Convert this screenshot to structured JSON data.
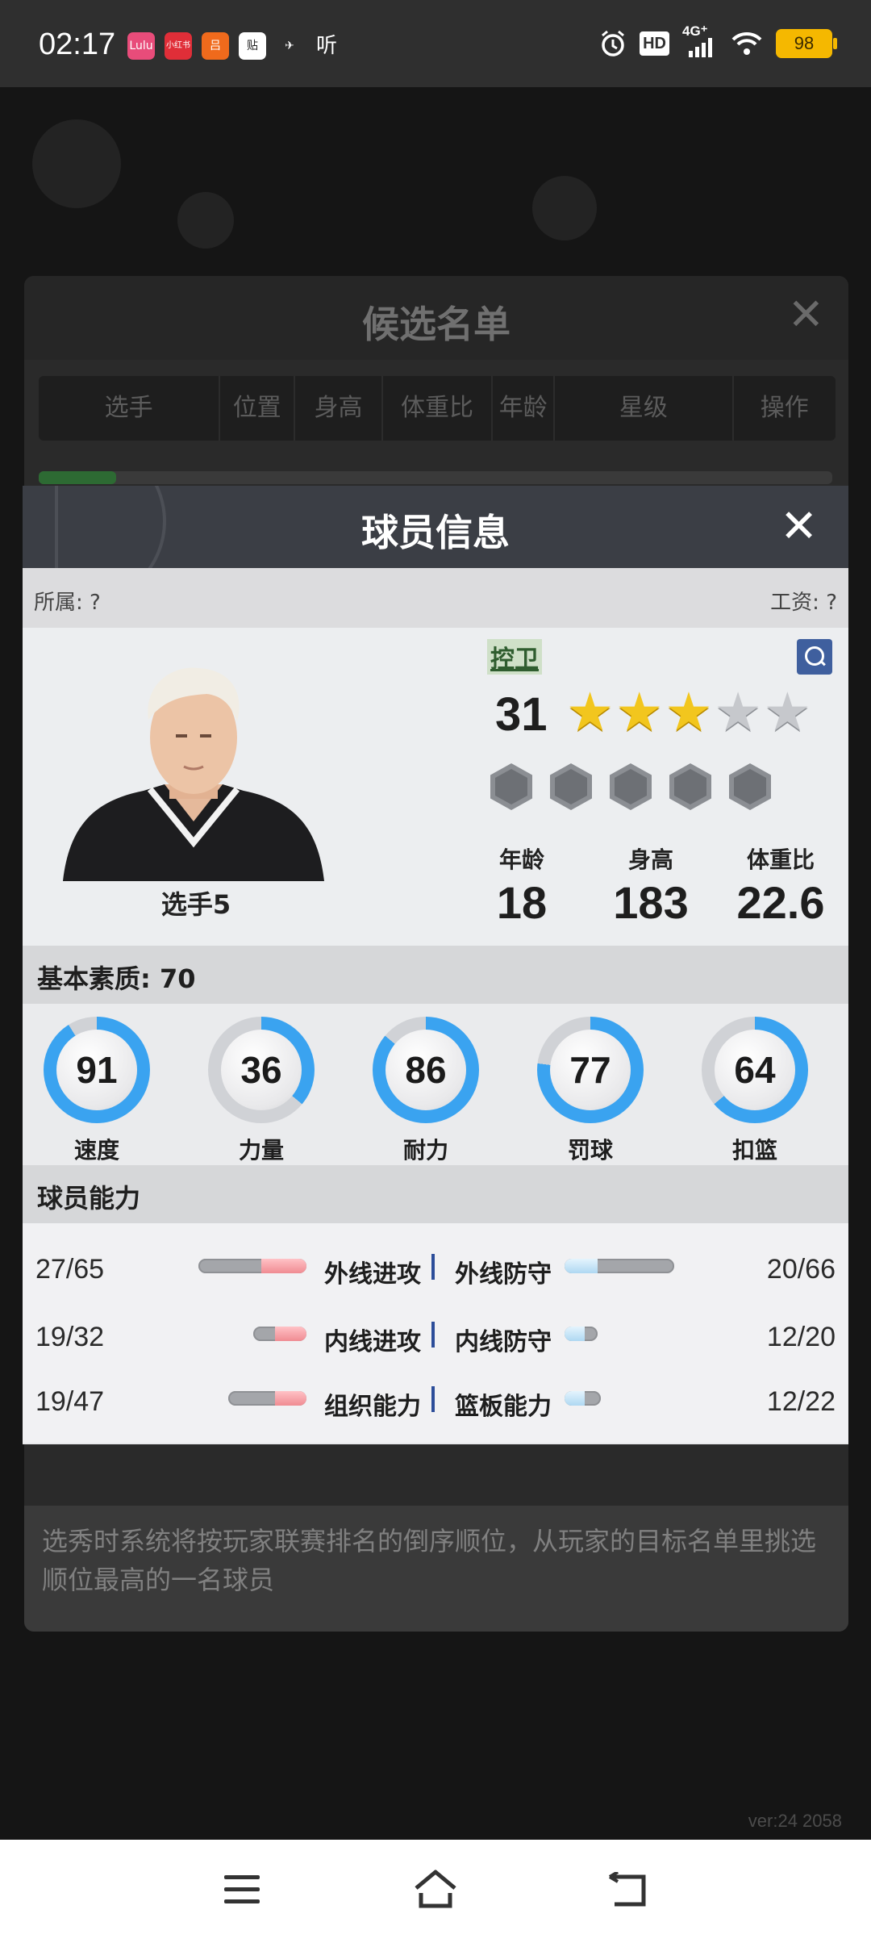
{
  "status_bar": {
    "time": "02:17",
    "apps": [
      "Lulu",
      "小红书",
      "吕",
      "贴",
      "✈",
      "听"
    ],
    "net_label": "4G⁺",
    "hd_label": "HD",
    "battery": "98"
  },
  "background": {
    "candidate_title": "候选名单",
    "columns": [
      "选手",
      "位置",
      "身高",
      "体重比",
      "年龄",
      "星级",
      "操作"
    ],
    "note": "选秀时系统将按玩家联赛排名的倒序顺位，从玩家的目标名单里挑选顺位最高的一名球员",
    "version": "ver:24  2058"
  },
  "modal": {
    "title": "球员信息",
    "affiliation": "所属: ?",
    "salary": "工资: ?",
    "player": {
      "name": "选手5",
      "position": "控卫",
      "rating": "31",
      "stars_filled": 3,
      "stars_total": 5,
      "age_label": "年龄",
      "age": "18",
      "height_label": "身高",
      "height": "183",
      "bmi_label": "体重比",
      "bmi": "22.6"
    },
    "basic_quality": "基本素质: 70",
    "attributes": [
      {
        "label": "速度",
        "value": "91"
      },
      {
        "label": "力量",
        "value": "36"
      },
      {
        "label": "耐力",
        "value": "86"
      },
      {
        "label": "罚球",
        "value": "77"
      },
      {
        "label": "扣篮",
        "value": "64"
      }
    ],
    "ability_title": "球员能力",
    "abilities": [
      {
        "left_value": "27/65",
        "left_name": "外线进攻",
        "left_cur": 27,
        "left_max": 65,
        "right_name": "外线防守",
        "right_value": "20/66",
        "right_cur": 20,
        "right_max": 66
      },
      {
        "left_value": "19/32",
        "left_name": "内线进攻",
        "left_cur": 19,
        "left_max": 32,
        "right_name": "内线防守",
        "right_value": "12/20",
        "right_cur": 12,
        "right_max": 20
      },
      {
        "left_value": "19/47",
        "left_name": "组织能力",
        "left_cur": 19,
        "left_max": 47,
        "right_name": "篮板能力",
        "right_value": "12/22",
        "right_cur": 12,
        "right_max": 22
      }
    ]
  },
  "colors": {
    "ring_fill": "#3aa3f0",
    "ring_track": "#d0d2d6",
    "bar_red": "#f08b92",
    "bar_blue": "#aed8f2",
    "star_gold": "#f2c61e"
  }
}
